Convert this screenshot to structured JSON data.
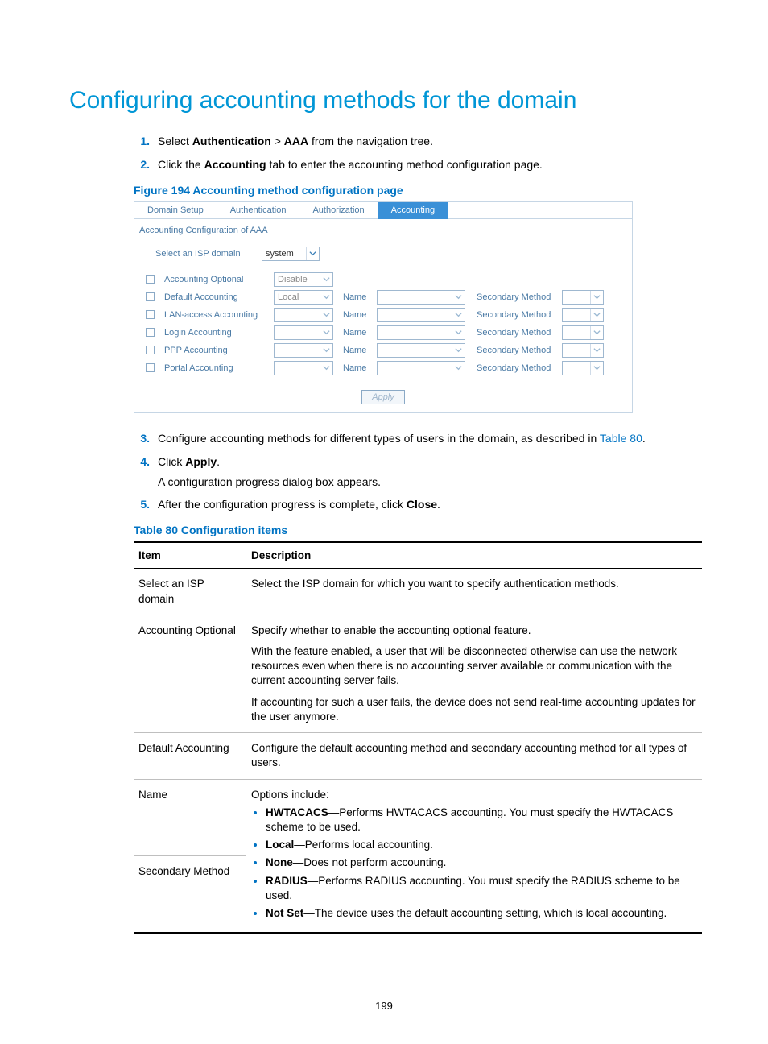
{
  "page_number": "199",
  "title": "Configuring accounting methods for the domain",
  "steps": [
    {
      "prefix": "Select ",
      "b1": "Authentication",
      "mid": " > ",
      "b2": "AAA",
      "suffix": " from the navigation tree."
    },
    {
      "prefix": "Click the ",
      "b1": "Accounting",
      "suffix": " tab to enter the accounting method configuration page."
    }
  ],
  "fig_caption": "Figure 194 Accounting method configuration page",
  "ui": {
    "tabs": [
      "Domain Setup",
      "Authentication",
      "Authorization",
      "Accounting"
    ],
    "active_tab": 3,
    "legend": "Accounting Configuration of AAA",
    "select_label": "Select an ISP domain",
    "select_value": "system",
    "rows_head": {
      "lbl": "Accounting Optional",
      "v1": "Disable"
    },
    "rows": [
      {
        "lbl": "Default Accounting",
        "v1": "Local",
        "name": "Name",
        "sm": "Secondary Method"
      },
      {
        "lbl": "LAN-access Accounting",
        "v1": "",
        "name": "Name",
        "sm": "Secondary Method"
      },
      {
        "lbl": "Login Accounting",
        "v1": "",
        "name": "Name",
        "sm": "Secondary Method"
      },
      {
        "lbl": "PPP Accounting",
        "v1": "",
        "name": "Name",
        "sm": "Secondary Method"
      },
      {
        "lbl": "Portal Accounting",
        "v1": "",
        "name": "Name",
        "sm": "Secondary Method"
      }
    ],
    "apply": "Apply"
  },
  "steps2": [
    {
      "prefix": "Configure accounting methods for different types of users in the domain, as described in ",
      "xref": "Table 80",
      "suffix": "."
    },
    {
      "prefix": "Click ",
      "b1": "Apply",
      "suffix": ".",
      "sub": "A configuration progress dialog box appears."
    },
    {
      "prefix": "After the configuration progress is complete, click ",
      "b1": "Close",
      "suffix": "."
    }
  ],
  "table_caption": "Table 80 Configuration items",
  "table": {
    "head": [
      "Item",
      "Description"
    ],
    "r1": {
      "item": "Select an ISP domain",
      "desc": "Select the ISP domain for which you want to specify authentication methods."
    },
    "r2": {
      "item": "Accounting Optional",
      "p1": "Specify whether to enable the accounting optional feature.",
      "p2": "With the feature enabled, a user that will be disconnected otherwise can use the network resources even when there is no accounting server available or communication with the current accounting server fails.",
      "p3": "If accounting for such a user fails, the device does not send real-time accounting updates for the user anymore."
    },
    "r3": {
      "item": "Default Accounting",
      "desc": "Configure the default accounting method and secondary accounting method for all types of users."
    },
    "r4": {
      "item": "Name",
      "lead": "Options include:",
      "o1b": "HWTACACS",
      "o1": "—Performs HWTACACS accounting. You must specify the HWTACACS scheme to be used."
    },
    "r5": {
      "item": "Secondary Method",
      "o2b": "Local",
      "o2": "—Performs local accounting.",
      "o3b": "None",
      "o3": "—Does not perform accounting.",
      "o4b": "RADIUS",
      "o4": "—Performs RADIUS accounting. You must specify the RADIUS scheme to be used.",
      "o5b": "Not Set",
      "o5": "—The device uses the default accounting setting, which is local accounting."
    }
  }
}
